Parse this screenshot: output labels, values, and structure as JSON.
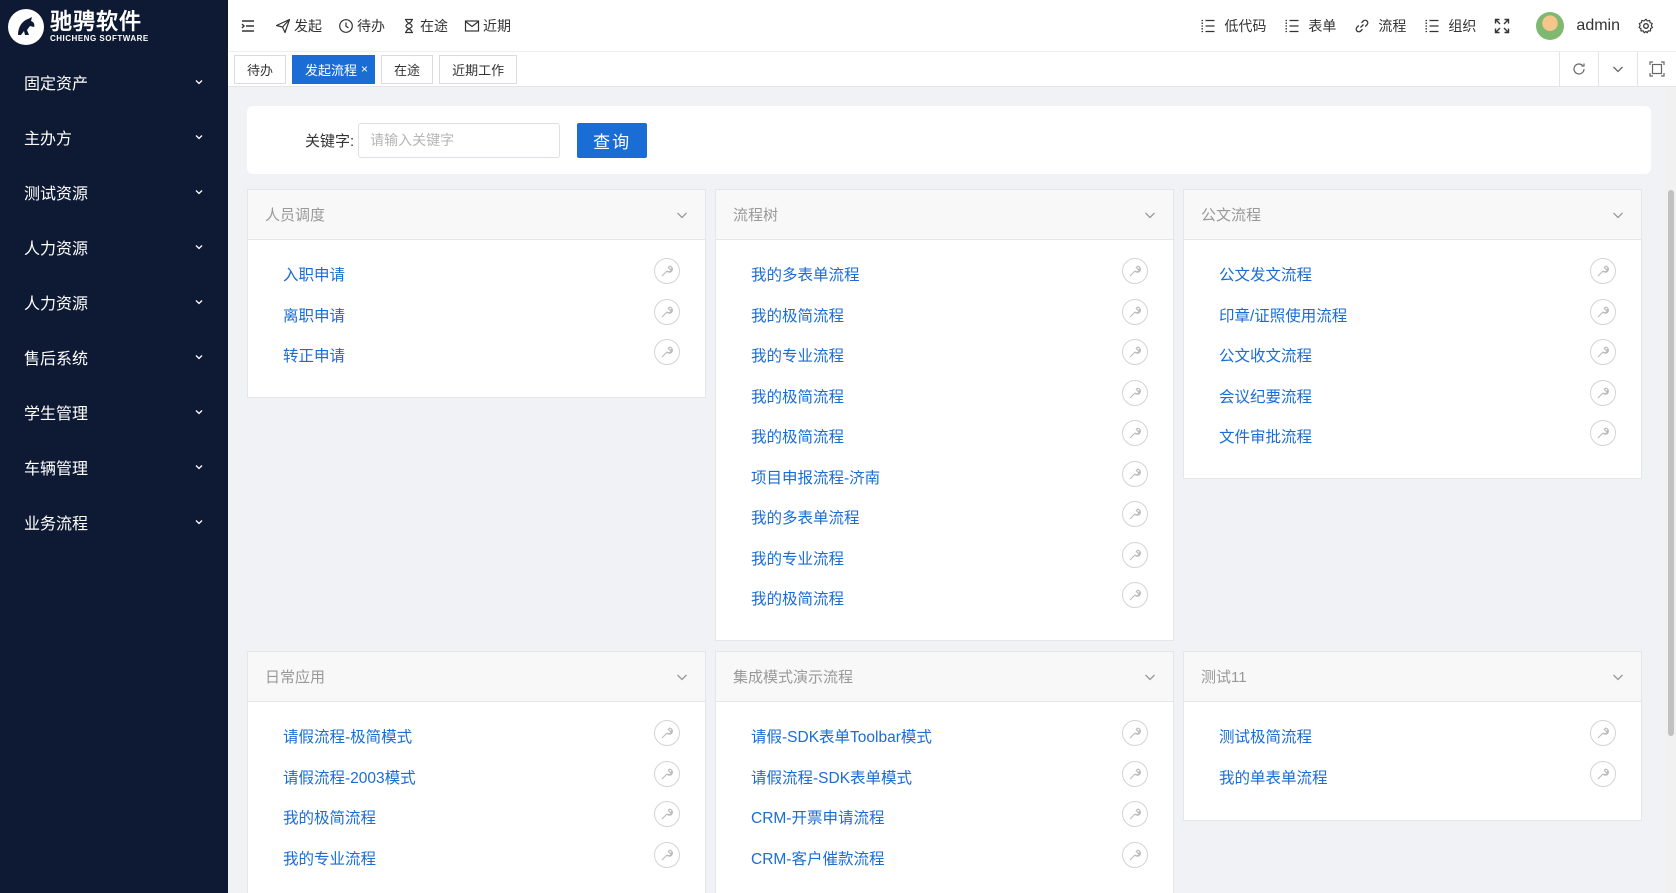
{
  "brand": {
    "name_cn": "驰骋软件",
    "name_en": "CHICHENG SOFTWARE"
  },
  "sidebar": {
    "items": [
      {
        "label": "固定资产"
      },
      {
        "label": "主办方"
      },
      {
        "label": "测试资源"
      },
      {
        "label": "人力资源"
      },
      {
        "label": "人力资源"
      },
      {
        "label": "售后系统"
      },
      {
        "label": "学生管理"
      },
      {
        "label": "车辆管理"
      },
      {
        "label": "业务流程"
      }
    ]
  },
  "header": {
    "left_buttons": [
      {
        "label": "发起",
        "icon": "send-icon"
      },
      {
        "label": "待办",
        "icon": "clock-icon"
      },
      {
        "label": "在途",
        "icon": "hourglass-icon"
      },
      {
        "label": "近期",
        "icon": "mail-icon"
      }
    ],
    "right_buttons": [
      {
        "label": "低代码",
        "icon": "list-icon"
      },
      {
        "label": "表单",
        "icon": "list-icon"
      },
      {
        "label": "流程",
        "icon": "link-icon"
      },
      {
        "label": "组织",
        "icon": "list-icon"
      }
    ],
    "username": "admin"
  },
  "tabs": [
    {
      "label": "待办",
      "active": false
    },
    {
      "label": "发起流程",
      "active": true,
      "close": "×"
    },
    {
      "label": "在途",
      "active": false
    },
    {
      "label": "近期工作",
      "active": false
    }
  ],
  "search": {
    "label": "关键字:",
    "placeholder": "请输入关键字",
    "value": "",
    "button": "查询"
  },
  "panels": [
    {
      "title": "人员调度",
      "items": [
        "入职申请",
        "离职申请",
        "转正申请"
      ]
    },
    {
      "title": "流程树",
      "items": [
        "我的多表单流程",
        "我的极简流程",
        "我的专业流程",
        "我的极简流程",
        "我的极简流程",
        "项目申报流程-济南",
        "我的多表单流程",
        "我的专业流程",
        "我的极简流程"
      ]
    },
    {
      "title": "公文流程",
      "items": [
        "公文发文流程",
        "印章/证照使用流程",
        "公文收文流程",
        "会议纪要流程",
        "文件审批流程"
      ]
    },
    {
      "title": "日常应用",
      "items": [
        "请假流程-极简模式",
        "请假流程-2003模式",
        "我的极简流程",
        "我的专业流程"
      ]
    },
    {
      "title": "集成模式演示流程",
      "items": [
        "请假-SDK表单Toolbar模式",
        "请假流程-SDK表单模式",
        "CRM-开票申请流程",
        "CRM-客户催款流程"
      ]
    },
    {
      "title": "测试11",
      "items": [
        "测试极简流程",
        "我的单表单流程"
      ]
    }
  ],
  "colors": {
    "sidebar_bg": "#0e1a33",
    "primary": "#1a6dd4",
    "link": "#1a6dd4"
  }
}
